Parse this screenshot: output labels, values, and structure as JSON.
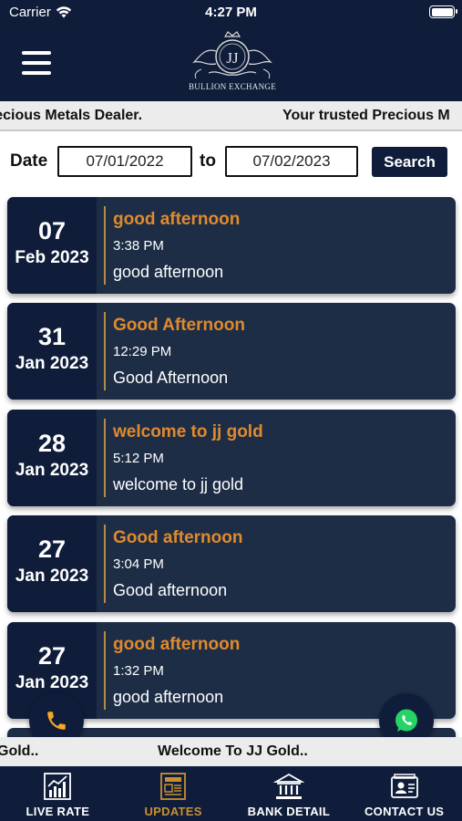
{
  "status_bar": {
    "carrier": "Carrier",
    "time": "4:27 PM"
  },
  "header": {
    "logo_monogram": "JJ",
    "logo_text": "BULLION EXCHANGE"
  },
  "ticker_top": [
    "recious Metals Dealer.",
    "Your trusted Precious M"
  ],
  "filter": {
    "date_label": "Date",
    "from_value": "07/01/2022",
    "to_label": "to",
    "to_value": "07/02/2023",
    "search_label": "Search"
  },
  "updates": [
    {
      "day": "07",
      "month": "Feb 2023",
      "title": "good afternoon",
      "time": "3:38 PM",
      "message": "good afternoon"
    },
    {
      "day": "31",
      "month": "Jan 2023",
      "title": "Good Afternoon",
      "time": "12:29 PM",
      "message": "Good Afternoon"
    },
    {
      "day": "28",
      "month": "Jan 2023",
      "title": "welcome to jj gold",
      "time": "5:12 PM",
      "message": "welcome to jj gold"
    },
    {
      "day": "27",
      "month": "Jan 2023",
      "title": "Good afternoon",
      "time": "3:04 PM",
      "message": "Good afternoon"
    },
    {
      "day": "27",
      "month": "Jan 2023",
      "title": "good afternoon",
      "time": "1:32 PM",
      "message": "good afternoon"
    }
  ],
  "ticker_bottom": [
    "Gold..",
    "Welcome To JJ Gold.."
  ],
  "tabs": [
    {
      "label": "LIVE RATE",
      "icon": "chart-icon"
    },
    {
      "label": "UPDATES",
      "icon": "newspaper-icon"
    },
    {
      "label": "BANK DETAIL",
      "icon": "bank-icon"
    },
    {
      "label": "CONTACT US",
      "icon": "contact-card-icon"
    }
  ],
  "colors": {
    "navy": "#0f1d3a",
    "card": "#1d2d46",
    "accent": "#e08a2c",
    "active_tab": "#c98f32",
    "whatsapp": "#25d366"
  }
}
